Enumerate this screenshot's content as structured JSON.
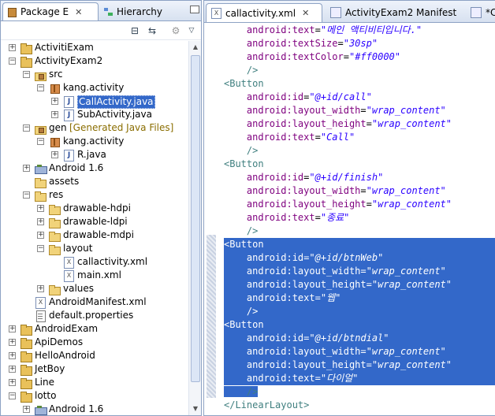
{
  "left_panel": {
    "tabs": [
      {
        "label": "Package E",
        "active": true
      },
      {
        "label": "Hierarchy",
        "active": false
      }
    ],
    "tree": [
      {
        "label": "ActivitiExam",
        "depth": 0,
        "expander": "+",
        "icon": "project"
      },
      {
        "label": "ActivityExam2",
        "depth": 0,
        "expander": "-",
        "icon": "project"
      },
      {
        "label": "src",
        "depth": 1,
        "expander": "-",
        "icon": "src-folder"
      },
      {
        "label": "kang.activity",
        "depth": 2,
        "expander": "-",
        "icon": "package"
      },
      {
        "label": "CallActivity.java",
        "depth": 3,
        "expander": "+",
        "icon": "java",
        "selected": true
      },
      {
        "label": "SubActivity.java",
        "depth": 3,
        "expander": "+",
        "icon": "java"
      },
      {
        "label": "gen",
        "decoration": "[Generated Java Files]",
        "depth": 1,
        "expander": "-",
        "icon": "src-folder"
      },
      {
        "label": "kang.activity",
        "depth": 2,
        "expander": "-",
        "icon": "package"
      },
      {
        "label": "R.java",
        "depth": 3,
        "expander": "+",
        "icon": "java"
      },
      {
        "label": "Android 1.6",
        "depth": 1,
        "expander": "+",
        "icon": "library"
      },
      {
        "label": "assets",
        "depth": 1,
        "expander": "",
        "icon": "folder"
      },
      {
        "label": "res",
        "depth": 1,
        "expander": "-",
        "icon": "folder"
      },
      {
        "label": "drawable-hdpi",
        "depth": 2,
        "expander": "+",
        "icon": "folder"
      },
      {
        "label": "drawable-ldpi",
        "depth": 2,
        "expander": "+",
        "icon": "folder"
      },
      {
        "label": "drawable-mdpi",
        "depth": 2,
        "expander": "+",
        "icon": "folder"
      },
      {
        "label": "layout",
        "depth": 2,
        "expander": "-",
        "icon": "folder"
      },
      {
        "label": "callactivity.xml",
        "depth": 3,
        "expander": "",
        "icon": "xml"
      },
      {
        "label": "main.xml",
        "depth": 3,
        "expander": "",
        "icon": "xml"
      },
      {
        "label": "values",
        "depth": 2,
        "expander": "+",
        "icon": "folder"
      },
      {
        "label": "AndroidManifest.xml",
        "depth": 1,
        "expander": "",
        "icon": "xml"
      },
      {
        "label": "default.properties",
        "depth": 1,
        "expander": "",
        "icon": "file"
      },
      {
        "label": "AndroidExam",
        "depth": 0,
        "expander": "+",
        "icon": "project"
      },
      {
        "label": "ApiDemos",
        "depth": 0,
        "expander": "+",
        "icon": "project"
      },
      {
        "label": "HelloAndroid",
        "depth": 0,
        "expander": "+",
        "icon": "project"
      },
      {
        "label": "JetBoy",
        "depth": 0,
        "expander": "+",
        "icon": "project"
      },
      {
        "label": "Line",
        "depth": 0,
        "expander": "+",
        "icon": "project"
      },
      {
        "label": "lotto",
        "depth": 0,
        "expander": "-",
        "icon": "project"
      },
      {
        "label": "Android 1.6",
        "depth": 1,
        "expander": "+",
        "icon": "library"
      }
    ]
  },
  "editor": {
    "tabs": [
      {
        "label": "callactivity.xml",
        "active": true
      },
      {
        "label": "ActivityExam2 Manifest",
        "active": false
      },
      {
        "label": "*Ca",
        "active": false
      }
    ],
    "lines": [
      {
        "indent": "    ",
        "parts": [
          [
            "attr",
            "android:text"
          ],
          [
            "eq",
            "="
          ],
          [
            "val",
            "\"메인 액티비티입니다.\""
          ]
        ]
      },
      {
        "indent": "    ",
        "parts": [
          [
            "attr",
            "android:textSize"
          ],
          [
            "eq",
            "="
          ],
          [
            "val",
            "\"30sp\""
          ]
        ]
      },
      {
        "indent": "    ",
        "parts": [
          [
            "attr",
            "android:textColor"
          ],
          [
            "eq",
            "="
          ],
          [
            "val",
            "\"#ff0000\""
          ]
        ]
      },
      {
        "indent": "    ",
        "parts": [
          [
            "tag",
            "/>"
          ]
        ]
      },
      {
        "indent": "",
        "parts": [
          [
            "tag",
            "<Button"
          ]
        ]
      },
      {
        "indent": "    ",
        "parts": [
          [
            "attr",
            "android:id"
          ],
          [
            "eq",
            "="
          ],
          [
            "val",
            "\"@+id/call\""
          ]
        ]
      },
      {
        "indent": "    ",
        "parts": [
          [
            "attr",
            "android:layout_width"
          ],
          [
            "eq",
            "="
          ],
          [
            "val",
            "\"wrap_content\""
          ]
        ]
      },
      {
        "indent": "    ",
        "parts": [
          [
            "attr",
            "android:layout_height"
          ],
          [
            "eq",
            "="
          ],
          [
            "val",
            "\"wrap_content\""
          ]
        ]
      },
      {
        "indent": "    ",
        "parts": [
          [
            "attr",
            "android:text"
          ],
          [
            "eq",
            "="
          ],
          [
            "val",
            "\"Call\""
          ]
        ]
      },
      {
        "indent": "    ",
        "parts": [
          [
            "tag",
            "/>"
          ]
        ]
      },
      {
        "indent": "",
        "parts": [
          [
            "tag",
            "<Button"
          ]
        ]
      },
      {
        "indent": "    ",
        "parts": [
          [
            "attr",
            "android:id"
          ],
          [
            "eq",
            "="
          ],
          [
            "val",
            "\"@+id/finish\""
          ]
        ]
      },
      {
        "indent": "    ",
        "parts": [
          [
            "attr",
            "android:layout_width"
          ],
          [
            "eq",
            "="
          ],
          [
            "val",
            "\"wrap_content\""
          ]
        ]
      },
      {
        "indent": "    ",
        "parts": [
          [
            "attr",
            "android:layout_height"
          ],
          [
            "eq",
            "="
          ],
          [
            "val",
            "\"wrap_content\""
          ]
        ]
      },
      {
        "indent": "    ",
        "parts": [
          [
            "attr",
            "android:text"
          ],
          [
            "eq",
            "="
          ],
          [
            "val",
            "\"종료\""
          ]
        ]
      },
      {
        "indent": "    ",
        "parts": [
          [
            "tag",
            "/>"
          ]
        ]
      },
      {
        "indent": "",
        "parts": [
          [
            "tag",
            "<Button"
          ]
        ],
        "selected": true
      },
      {
        "indent": "    ",
        "parts": [
          [
            "attr",
            "android:id"
          ],
          [
            "eq",
            "="
          ],
          [
            "val",
            "\"@+id/btnWeb\""
          ]
        ],
        "selected": true
      },
      {
        "indent": "    ",
        "parts": [
          [
            "attr",
            "android:layout_width"
          ],
          [
            "eq",
            "="
          ],
          [
            "val",
            "\"wrap_content\""
          ]
        ],
        "selected": true
      },
      {
        "indent": "    ",
        "parts": [
          [
            "attr",
            "android:layout_height"
          ],
          [
            "eq",
            "="
          ],
          [
            "val",
            "\"wrap_content\""
          ]
        ],
        "selected": true
      },
      {
        "indent": "    ",
        "parts": [
          [
            "attr",
            "android:text"
          ],
          [
            "eq",
            "="
          ],
          [
            "val",
            "\"웹\""
          ]
        ],
        "selected": true
      },
      {
        "indent": "    ",
        "parts": [
          [
            "tag",
            "/>"
          ]
        ],
        "selected": true
      },
      {
        "indent": "",
        "parts": [
          [
            "tag",
            "<Button"
          ]
        ],
        "selected": true
      },
      {
        "indent": "    ",
        "parts": [
          [
            "attr",
            "android:id"
          ],
          [
            "eq",
            "="
          ],
          [
            "val",
            "\"@+id/btndial\""
          ]
        ],
        "selected": true
      },
      {
        "indent": "    ",
        "parts": [
          [
            "attr",
            "android:layout_width"
          ],
          [
            "eq",
            "="
          ],
          [
            "val",
            "\"wrap_content\""
          ]
        ],
        "selected": true
      },
      {
        "indent": "    ",
        "parts": [
          [
            "attr",
            "android:layout_height"
          ],
          [
            "eq",
            "="
          ],
          [
            "val",
            "\"wrap_content\""
          ]
        ],
        "selected": true
      },
      {
        "indent": "    ",
        "parts": [
          [
            "attr",
            "android:text"
          ],
          [
            "eq",
            "="
          ],
          [
            "val",
            "\"다이얼\""
          ]
        ],
        "selected": true
      },
      {
        "indent": "    ",
        "parts": [
          [
            "tag",
            "/>"
          ]
        ],
        "selected": "partial"
      },
      {
        "indent": "",
        "parts": [
          [
            "tag",
            "</LinearLayout>"
          ]
        ]
      }
    ]
  },
  "colors": {
    "selection": "#3368c9",
    "tag": "#3f7f7f",
    "attribute": "#7f007f",
    "value": "#2a00ff",
    "panel_border": "#8da2c4"
  }
}
